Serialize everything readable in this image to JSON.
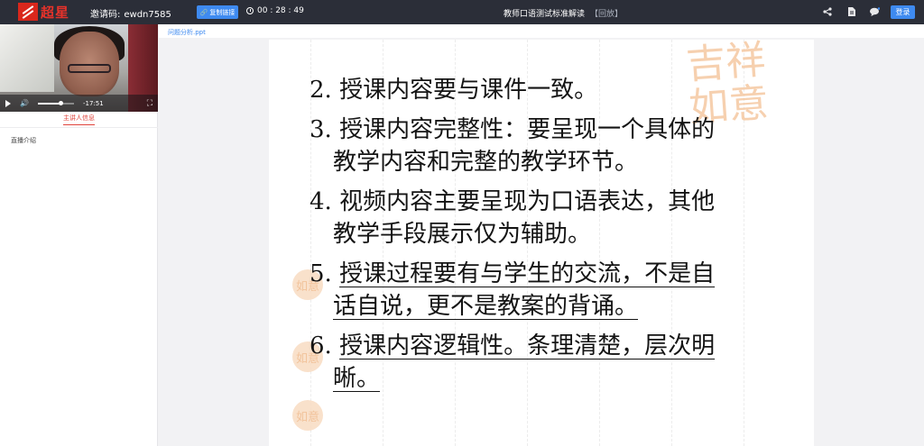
{
  "topbar": {
    "logo_text": "超星",
    "invite_label": "邀请码:",
    "invite_code": "ewdn7585",
    "copy_button": "复制链接",
    "timer": "00 : 28 : 49",
    "title": "教师口语测试标准解读",
    "replay_badge": "【回放】",
    "login_button": "登录",
    "icons": [
      "share-icon",
      "document-icon",
      "chat-icon"
    ]
  },
  "video": {
    "time_remaining": "-17:51",
    "progress_fraction": 0.62
  },
  "left_panel": {
    "host_tab": "主讲人信息",
    "intro_label": "直播介绍"
  },
  "file": {
    "name": "问题分析.ppt"
  },
  "slide": {
    "items": [
      {
        "num": "2.",
        "lines": [
          "授课内容要与课件一致。"
        ],
        "underlined": false
      },
      {
        "num": "3.",
        "lines": [
          "授课内容完整性：要呈现一个具体的",
          "教学内容和完整的教学环节。"
        ],
        "underlined": false
      },
      {
        "num": "4.",
        "lines": [
          "视频内容主要呈现为口语表达，其他",
          "教学手段展示仅为辅助。"
        ],
        "underlined": false
      },
      {
        "num": "5.",
        "lines": [
          "授课过程要有与学生的交流，不是自",
          "话自说，更不是教案的背诵。"
        ],
        "underlined": true
      },
      {
        "num": "6.",
        "lines": [
          "授课内容逻辑性。条理清楚，层次明",
          "晰。"
        ],
        "underlined": true
      }
    ]
  },
  "colors": {
    "topbar_bg": "#2b2e38",
    "accent_blue": "#3e8af0",
    "accent_red": "#e0443c"
  }
}
